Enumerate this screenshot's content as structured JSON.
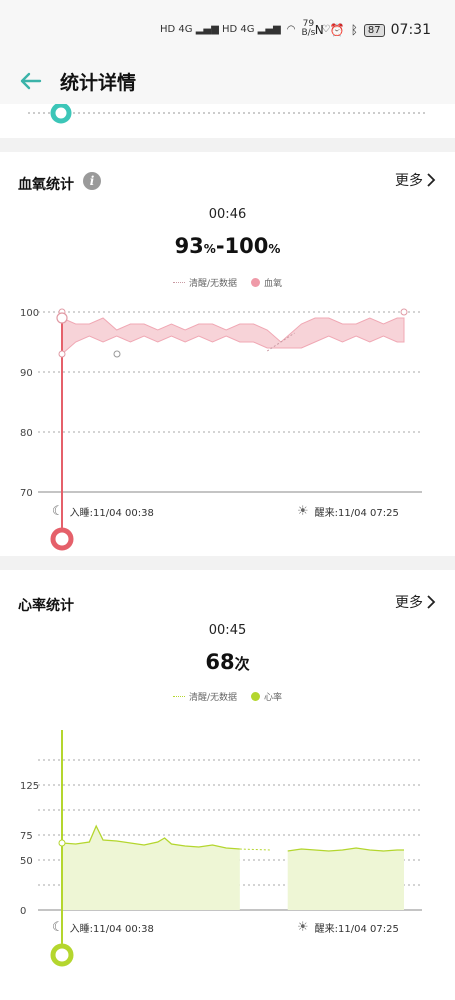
{
  "status_bar": {
    "net_speed_value": "79",
    "net_speed_unit": "B/s",
    "battery": "87",
    "time": "07:31"
  },
  "header": {
    "title": "统计详情"
  },
  "spo2": {
    "title": "血氧统计",
    "more": "更多",
    "time": "00:46",
    "value_low": "93",
    "value_high": "100",
    "unit": "%",
    "legend_awake": "清醒/无数据",
    "legend_series": "血氧",
    "sleep_label": "入睡:11/04 00:38",
    "wake_label": "醒来:11/04 07:25",
    "colors": {
      "accent": "#e5606a",
      "fill": "#f7d3d8"
    }
  },
  "hr": {
    "title": "心率统计",
    "more": "更多",
    "time": "00:45",
    "value": "68",
    "unit": "次",
    "legend_awake": "清醒/无数据",
    "legend_series": "心率",
    "sleep_label": "入睡:11/04 00:38",
    "wake_label": "醒来:11/04 07:25",
    "colors": {
      "accent": "#b4d62e",
      "fill": "#eef6d5"
    }
  },
  "chart_data": [
    {
      "type": "area",
      "ylim": [
        70,
        100
      ],
      "yticks": [
        "100",
        "90",
        "80",
        "70"
      ],
      "xlabel": "",
      "ylabel": "",
      "series": [
        {
          "name": "血氧",
          "x": [
            0,
            0.04,
            0.08,
            0.12,
            0.16,
            0.2,
            0.24,
            0.28,
            0.32,
            0.36,
            0.4,
            0.44,
            0.48,
            0.52,
            0.56,
            0.6,
            0.64,
            0.7,
            0.74,
            0.78,
            0.82,
            0.86,
            0.9,
            0.94,
            0.98,
            1.0
          ],
          "high": [
            99,
            98,
            98,
            99,
            97,
            98,
            98,
            97,
            98,
            97,
            98,
            98,
            97,
            98,
            98,
            97,
            95,
            98,
            99,
            99,
            98,
            98,
            99,
            98,
            99,
            99
          ],
          "low": [
            93,
            95,
            96,
            95,
            96,
            95,
            96,
            95,
            96,
            95,
            96,
            95,
            96,
            95,
            95,
            94,
            94,
            94,
            95,
            96,
            95,
            96,
            95,
            96,
            95,
            95
          ]
        }
      ]
    },
    {
      "type": "area",
      "ylim": [
        0,
        150
      ],
      "yticks": [
        "125",
        "75",
        "50",
        "0"
      ],
      "xlabel": "",
      "ylabel": "",
      "series": [
        {
          "name": "心率",
          "x": [
            0,
            0.04,
            0.08,
            0.1,
            0.12,
            0.16,
            0.2,
            0.24,
            0.28,
            0.3,
            0.32,
            0.36,
            0.4,
            0.44,
            0.48,
            0.52,
            0.56,
            0.6,
            0.66,
            0.7,
            0.74,
            0.78,
            0.82,
            0.86,
            0.9,
            0.94,
            0.98,
            1.0
          ],
          "values": [
            67,
            66,
            68,
            84,
            70,
            69,
            67,
            65,
            68,
            72,
            66,
            64,
            63,
            65,
            62,
            61,
            60,
            60,
            59,
            61,
            60,
            59,
            60,
            62,
            60,
            59,
            60,
            60
          ]
        }
      ]
    }
  ]
}
